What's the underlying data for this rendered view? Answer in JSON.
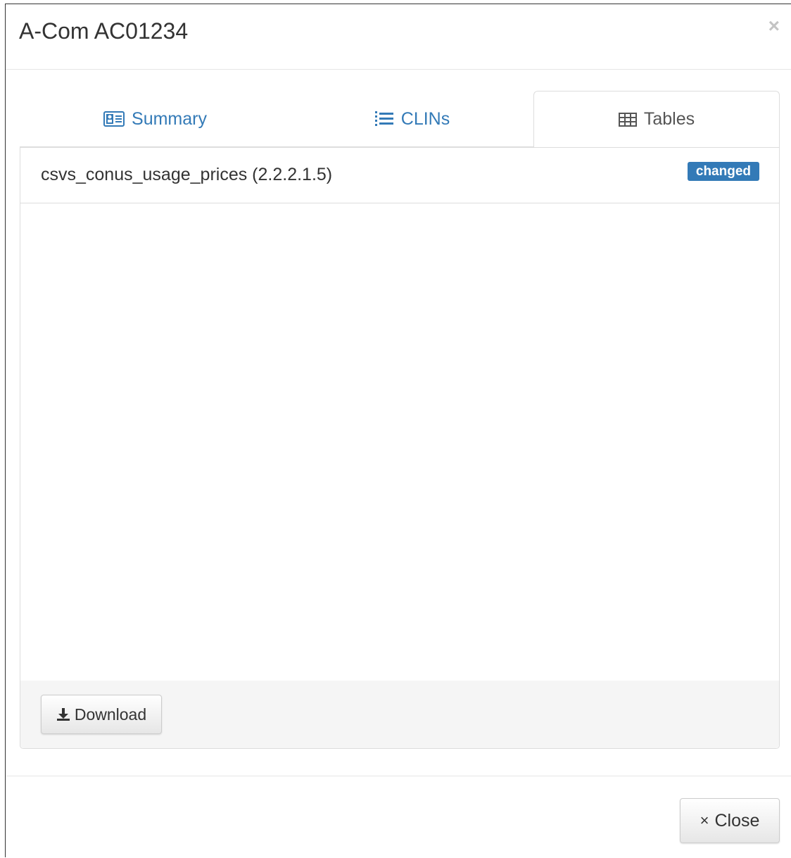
{
  "modal": {
    "title": "A-Com AC01234",
    "close_glyph": "×"
  },
  "tabs": [
    {
      "label": "Summary",
      "icon": "id-card-icon",
      "active": false
    },
    {
      "label": "CLINs",
      "icon": "list-icon",
      "active": false
    },
    {
      "label": "Tables",
      "icon": "table-icon",
      "active": true
    }
  ],
  "panel": {
    "title": "csvs_conus_usage_prices (2.2.2.1.5)",
    "badge": "changed",
    "download_label": "Download"
  },
  "footer": {
    "close_glyph": "×",
    "close_label": "Close"
  },
  "colors": {
    "link": "#337ab7",
    "badge_bg": "#337ab7",
    "footer_bg": "#f5f5f5"
  }
}
